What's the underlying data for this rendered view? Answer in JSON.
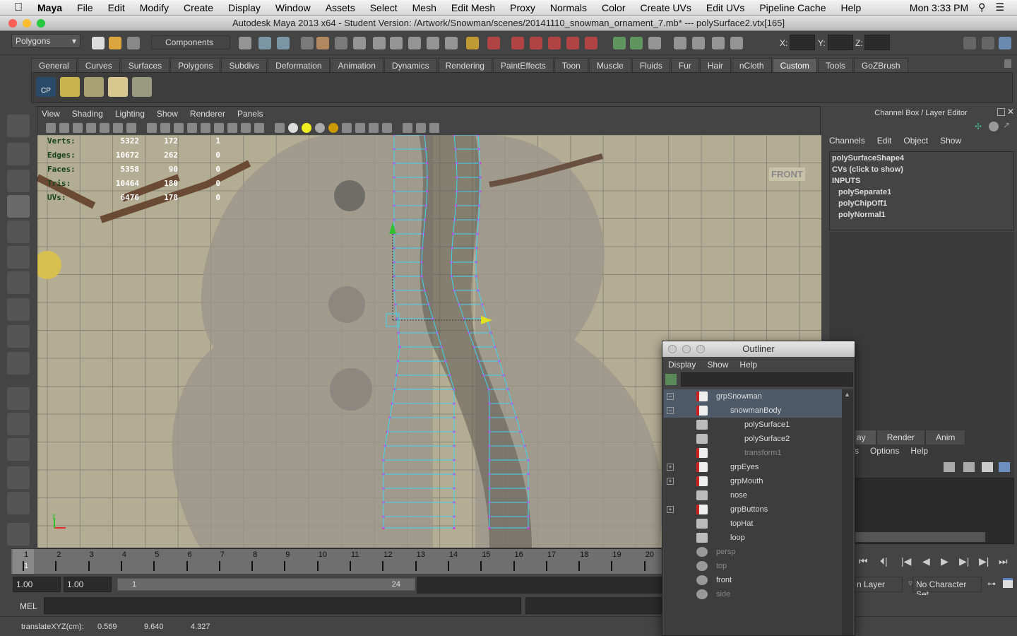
{
  "menubar": {
    "app": "Maya",
    "items": [
      "File",
      "Edit",
      "Modify",
      "Create",
      "Display",
      "Window",
      "Assets",
      "Select",
      "Mesh",
      "Edit Mesh",
      "Proxy",
      "Normals",
      "Color",
      "Create UVs",
      "Edit UVs",
      "Pipeline Cache",
      "Help"
    ],
    "clock": "Mon 3:33 PM"
  },
  "window": {
    "title": "Autodesk Maya 2013 x64 - Student Version: /Artwork/Snowman/scenes/20141110_snowman_ornament_7.mb*  ---   polySurface2.vtx[165]"
  },
  "statusline": {
    "menuset": "Polygons",
    "selection_mode": "Components",
    "x_label": "X:",
    "y_label": "Y:",
    "z_label": "Z:"
  },
  "shelf": {
    "tabs": [
      "General",
      "Curves",
      "Surfaces",
      "Polygons",
      "Subdivs",
      "Deformation",
      "Animation",
      "Dynamics",
      "Rendering",
      "PaintEffects",
      "Toon",
      "Muscle",
      "Fluids",
      "Fur",
      "Hair",
      "nCloth",
      "Custom",
      "Tools",
      "GoZBrush"
    ],
    "active_tab": "Custom",
    "cp_label": "CP"
  },
  "viewport": {
    "menu": [
      "View",
      "Shading",
      "Lighting",
      "Show",
      "Renderer",
      "Panels"
    ],
    "hud": [
      {
        "label": "Verts:",
        "v": [
          "5322",
          "172",
          "1"
        ]
      },
      {
        "label": "Edges:",
        "v": [
          "10672",
          "262",
          "0"
        ]
      },
      {
        "label": "Faces:",
        "v": [
          "5358",
          "90",
          "0"
        ]
      },
      {
        "label": "Tris:",
        "v": [
          "10464",
          "180",
          "0"
        ]
      },
      {
        "label": "UVs:",
        "v": [
          "6476",
          "178",
          "0"
        ]
      }
    ],
    "camera_label": "FRONT",
    "axis_y": "y",
    "wire_color": "#3fd4f0",
    "vertex_color": "#e020e0"
  },
  "channel_box": {
    "title": "Channel Box / Layer Editor",
    "menu": [
      "Channels",
      "Edit",
      "Object",
      "Show"
    ],
    "shape": "polySurfaceShape4",
    "cvs": "CVs (click to show)",
    "inputs_label": "INPUTS",
    "inputs": [
      "polySeparate1",
      "polyChipOff1",
      "polyNormal1"
    ]
  },
  "layer_editor": {
    "tabs": [
      "ay",
      "Render",
      "Anim"
    ],
    "menu": [
      "s",
      "Options",
      "Help"
    ]
  },
  "timeline": {
    "ticks": [
      "1",
      "2",
      "3",
      "4",
      "5",
      "6",
      "7",
      "8",
      "9",
      "10",
      "11",
      "12",
      "13",
      "14",
      "15",
      "16",
      "17",
      "18",
      "19",
      "20"
    ],
    "current_frame": "1"
  },
  "range": {
    "start": "1.00",
    "playback_start": "1.00",
    "range_start": "1",
    "range_end": "24",
    "anim_layer": "n Layer",
    "character_set": "No Character Set"
  },
  "mel": {
    "label": "MEL"
  },
  "helpline": {
    "label": "translateXYZ(cm):",
    "x": "0.569",
    "y": "9.640",
    "z": "4.327"
  },
  "outliner": {
    "title": "Outliner",
    "menu": [
      "Display",
      "Show",
      "Help"
    ],
    "items": [
      {
        "name": "grpSnowman",
        "indent": 0,
        "exp": "−",
        "sel": true,
        "dim": false,
        "icon": "transform"
      },
      {
        "name": "snowmanBody",
        "indent": 1,
        "exp": "−",
        "sel": true,
        "dim": false,
        "icon": "transform"
      },
      {
        "name": "polySurface1",
        "indent": 2,
        "exp": "",
        "sel": false,
        "dim": false,
        "icon": "mesh"
      },
      {
        "name": "polySurface2",
        "indent": 2,
        "exp": "",
        "sel": false,
        "dim": false,
        "icon": "mesh"
      },
      {
        "name": "transform1",
        "indent": 2,
        "exp": "",
        "sel": false,
        "dim": true,
        "icon": "transform"
      },
      {
        "name": "grpEyes",
        "indent": 1,
        "exp": "+",
        "sel": false,
        "dim": false,
        "icon": "transform"
      },
      {
        "name": "grpMouth",
        "indent": 1,
        "exp": "+",
        "sel": false,
        "dim": false,
        "icon": "transform"
      },
      {
        "name": "nose",
        "indent": 1,
        "exp": "",
        "sel": false,
        "dim": false,
        "icon": "mesh"
      },
      {
        "name": "grpButtons",
        "indent": 1,
        "exp": "+",
        "sel": false,
        "dim": false,
        "icon": "transform"
      },
      {
        "name": "topHat",
        "indent": 1,
        "exp": "",
        "sel": false,
        "dim": false,
        "icon": "mesh"
      },
      {
        "name": "loop",
        "indent": 1,
        "exp": "",
        "sel": false,
        "dim": false,
        "icon": "mesh"
      },
      {
        "name": "persp",
        "indent": 0,
        "exp": "",
        "sel": false,
        "dim": true,
        "icon": "camera"
      },
      {
        "name": "top",
        "indent": 0,
        "exp": "",
        "sel": false,
        "dim": true,
        "icon": "camera"
      },
      {
        "name": "front",
        "indent": 0,
        "exp": "",
        "sel": false,
        "dim": false,
        "icon": "camera"
      },
      {
        "name": "side",
        "indent": 0,
        "exp": "",
        "sel": false,
        "dim": true,
        "icon": "camera"
      }
    ]
  }
}
